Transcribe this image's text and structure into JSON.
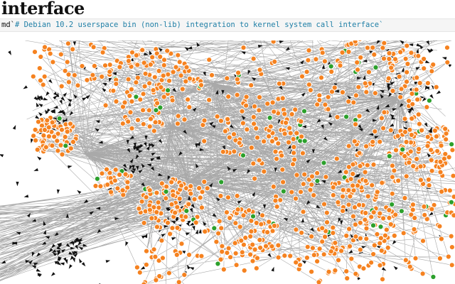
{
  "page": {
    "title": "interface"
  },
  "code_cell": {
    "prefix": "md`",
    "text": "# Debian 10.2 userspace bin (non-lib) integration to kernel system call interface`"
  },
  "graph": {
    "node_colors": {
      "syscall": "#f58220",
      "binary": "#2ca02c",
      "edge": "#a9a9a9",
      "arrow": "#111111",
      "node_stroke": "#ffffff"
    }
  }
}
